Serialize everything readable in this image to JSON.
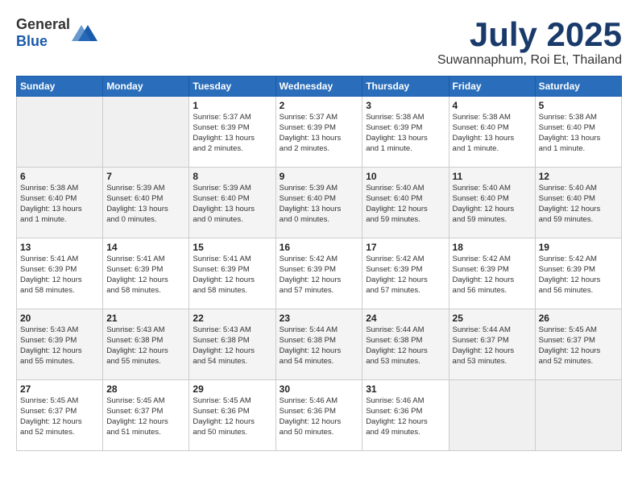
{
  "header": {
    "logo": {
      "general": "General",
      "blue": "Blue"
    },
    "title": "July 2025",
    "subtitle": "Suwannaphum, Roi Et, Thailand"
  },
  "weekdays": [
    "Sunday",
    "Monday",
    "Tuesday",
    "Wednesday",
    "Thursday",
    "Friday",
    "Saturday"
  ],
  "weeks": [
    [
      {
        "day": "",
        "info": ""
      },
      {
        "day": "",
        "info": ""
      },
      {
        "day": "1",
        "info": "Sunrise: 5:37 AM\nSunset: 6:39 PM\nDaylight: 13 hours\nand 2 minutes."
      },
      {
        "day": "2",
        "info": "Sunrise: 5:37 AM\nSunset: 6:39 PM\nDaylight: 13 hours\nand 2 minutes."
      },
      {
        "day": "3",
        "info": "Sunrise: 5:38 AM\nSunset: 6:39 PM\nDaylight: 13 hours\nand 1 minute."
      },
      {
        "day": "4",
        "info": "Sunrise: 5:38 AM\nSunset: 6:40 PM\nDaylight: 13 hours\nand 1 minute."
      },
      {
        "day": "5",
        "info": "Sunrise: 5:38 AM\nSunset: 6:40 PM\nDaylight: 13 hours\nand 1 minute."
      }
    ],
    [
      {
        "day": "6",
        "info": "Sunrise: 5:38 AM\nSunset: 6:40 PM\nDaylight: 13 hours\nand 1 minute."
      },
      {
        "day": "7",
        "info": "Sunrise: 5:39 AM\nSunset: 6:40 PM\nDaylight: 13 hours\nand 0 minutes."
      },
      {
        "day": "8",
        "info": "Sunrise: 5:39 AM\nSunset: 6:40 PM\nDaylight: 13 hours\nand 0 minutes."
      },
      {
        "day": "9",
        "info": "Sunrise: 5:39 AM\nSunset: 6:40 PM\nDaylight: 13 hours\nand 0 minutes."
      },
      {
        "day": "10",
        "info": "Sunrise: 5:40 AM\nSunset: 6:40 PM\nDaylight: 12 hours\nand 59 minutes."
      },
      {
        "day": "11",
        "info": "Sunrise: 5:40 AM\nSunset: 6:40 PM\nDaylight: 12 hours\nand 59 minutes."
      },
      {
        "day": "12",
        "info": "Sunrise: 5:40 AM\nSunset: 6:40 PM\nDaylight: 12 hours\nand 59 minutes."
      }
    ],
    [
      {
        "day": "13",
        "info": "Sunrise: 5:41 AM\nSunset: 6:39 PM\nDaylight: 12 hours\nand 58 minutes."
      },
      {
        "day": "14",
        "info": "Sunrise: 5:41 AM\nSunset: 6:39 PM\nDaylight: 12 hours\nand 58 minutes."
      },
      {
        "day": "15",
        "info": "Sunrise: 5:41 AM\nSunset: 6:39 PM\nDaylight: 12 hours\nand 58 minutes."
      },
      {
        "day": "16",
        "info": "Sunrise: 5:42 AM\nSunset: 6:39 PM\nDaylight: 12 hours\nand 57 minutes."
      },
      {
        "day": "17",
        "info": "Sunrise: 5:42 AM\nSunset: 6:39 PM\nDaylight: 12 hours\nand 57 minutes."
      },
      {
        "day": "18",
        "info": "Sunrise: 5:42 AM\nSunset: 6:39 PM\nDaylight: 12 hours\nand 56 minutes."
      },
      {
        "day": "19",
        "info": "Sunrise: 5:42 AM\nSunset: 6:39 PM\nDaylight: 12 hours\nand 56 minutes."
      }
    ],
    [
      {
        "day": "20",
        "info": "Sunrise: 5:43 AM\nSunset: 6:39 PM\nDaylight: 12 hours\nand 55 minutes."
      },
      {
        "day": "21",
        "info": "Sunrise: 5:43 AM\nSunset: 6:38 PM\nDaylight: 12 hours\nand 55 minutes."
      },
      {
        "day": "22",
        "info": "Sunrise: 5:43 AM\nSunset: 6:38 PM\nDaylight: 12 hours\nand 54 minutes."
      },
      {
        "day": "23",
        "info": "Sunrise: 5:44 AM\nSunset: 6:38 PM\nDaylight: 12 hours\nand 54 minutes."
      },
      {
        "day": "24",
        "info": "Sunrise: 5:44 AM\nSunset: 6:38 PM\nDaylight: 12 hours\nand 53 minutes."
      },
      {
        "day": "25",
        "info": "Sunrise: 5:44 AM\nSunset: 6:37 PM\nDaylight: 12 hours\nand 53 minutes."
      },
      {
        "day": "26",
        "info": "Sunrise: 5:45 AM\nSunset: 6:37 PM\nDaylight: 12 hours\nand 52 minutes."
      }
    ],
    [
      {
        "day": "27",
        "info": "Sunrise: 5:45 AM\nSunset: 6:37 PM\nDaylight: 12 hours\nand 52 minutes."
      },
      {
        "day": "28",
        "info": "Sunrise: 5:45 AM\nSunset: 6:37 PM\nDaylight: 12 hours\nand 51 minutes."
      },
      {
        "day": "29",
        "info": "Sunrise: 5:45 AM\nSunset: 6:36 PM\nDaylight: 12 hours\nand 50 minutes."
      },
      {
        "day": "30",
        "info": "Sunrise: 5:46 AM\nSunset: 6:36 PM\nDaylight: 12 hours\nand 50 minutes."
      },
      {
        "day": "31",
        "info": "Sunrise: 5:46 AM\nSunset: 6:36 PM\nDaylight: 12 hours\nand 49 minutes."
      },
      {
        "day": "",
        "info": ""
      },
      {
        "day": "",
        "info": ""
      }
    ]
  ]
}
